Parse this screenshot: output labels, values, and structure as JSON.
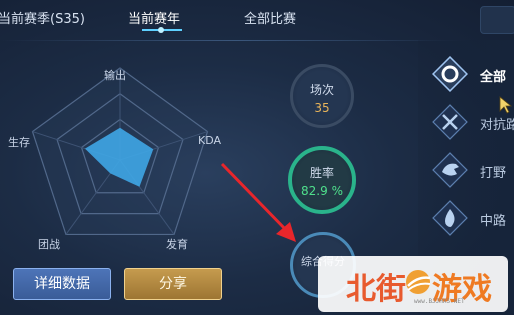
{
  "tabs": [
    {
      "label": "当前赛季(S35)",
      "active": false
    },
    {
      "label": "当前赛年",
      "active": true
    },
    {
      "label": "全部比赛",
      "active": false
    }
  ],
  "radar": {
    "axes": [
      "输出",
      "KDA",
      "发育",
      "团战",
      "生存"
    ],
    "values": [
      0.35,
      0.38,
      0.36,
      0.18,
      0.4
    ],
    "fill_color": "#3fa6e6"
  },
  "buttons": {
    "detail": "详细数据",
    "share": "分享"
  },
  "stats": {
    "matches": {
      "label": "场次",
      "value": "35"
    },
    "winrate": {
      "label": "胜率",
      "value": "82.9 %"
    },
    "score": {
      "label": "综合得分"
    }
  },
  "modes": [
    {
      "label": "全部",
      "icon": "ring-icon",
      "active": true
    },
    {
      "label": "对抗路",
      "icon": "crossed-swords-icon",
      "active": false
    },
    {
      "label": "打野",
      "icon": "beast-head-icon",
      "active": false
    },
    {
      "label": "中路",
      "icon": "flame-icon",
      "active": false
    }
  ],
  "watermark": {
    "left": "北街",
    "right": "游戏",
    "url": "www.BJJHXS.NET"
  },
  "colors": {
    "accent": "#5fd0ff",
    "win_green": "#4fe08c",
    "match_orange": "#e8b45a",
    "share_gold": "#c59b4e",
    "detail_blue": "#4d74b8"
  }
}
